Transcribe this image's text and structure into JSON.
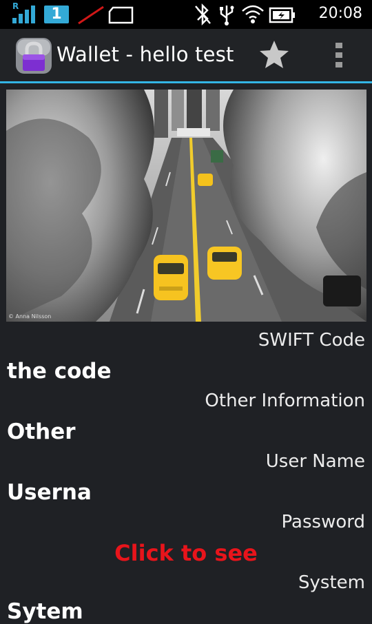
{
  "status_bar": {
    "roaming_badge": "R",
    "sim_number": "1",
    "time": "20:08"
  },
  "action_bar": {
    "title": "Wallet - hello test",
    "icons": [
      "lock-app-icon",
      "star-icon",
      "overflow-menu-icon"
    ]
  },
  "photo": {
    "credit": "© Anna Nilsson",
    "description_icon": "city-street-taxis-photo"
  },
  "fields": [
    {
      "label": "SWIFT Code",
      "value": "the code"
    },
    {
      "label": "Other Information",
      "value": "Other"
    },
    {
      "label": "User Name",
      "value": "Userna"
    },
    {
      "label": "Password",
      "value": "Click to see"
    },
    {
      "label": "System",
      "value": "Sytem"
    }
  ],
  "colors": {
    "accent": "#33b5e5",
    "reveal": "#e8141b",
    "background": "#1f2125"
  }
}
